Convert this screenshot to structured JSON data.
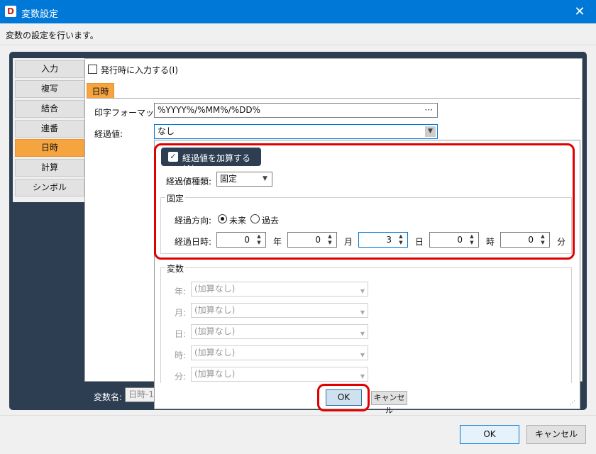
{
  "window": {
    "title": "変数設定",
    "icon_letter": "D",
    "close_glyph": "✕"
  },
  "description": "変数の設定を行います。",
  "nav": {
    "items": [
      "入力",
      "複写",
      "結合",
      "連番",
      "日時",
      "計算",
      "シンボル"
    ],
    "active_index": 4
  },
  "input_on_issue": {
    "label": "発行時に入力する(I)",
    "checked": false
  },
  "tab_label": "日時",
  "print_format": {
    "label": "印字フォーマット:",
    "value": "%YYYY%/%MM%/%DD%",
    "button": "···"
  },
  "elapsed": {
    "label": "経過値:",
    "value": "なし"
  },
  "popup": {
    "add_checkbox_label": "経過値を加算する(A)",
    "add_checked": true,
    "type_label": "経過値種類:",
    "type_value": "固定",
    "fixed_group": "固定",
    "direction_label": "経過方向:",
    "direction_future": "未来",
    "direction_past": "過去",
    "direction_selected": "未来",
    "datetime_label": "経過日時:",
    "spins": [
      {
        "value": "0",
        "unit": "年"
      },
      {
        "value": "0",
        "unit": "月"
      },
      {
        "value": "3",
        "unit": "日"
      },
      {
        "value": "0",
        "unit": "時"
      },
      {
        "value": "0",
        "unit": "分"
      }
    ],
    "variable_group": "変数",
    "variable_rows": [
      {
        "label": "年:",
        "value": "(加算なし)"
      },
      {
        "label": "月:",
        "value": "(加算なし)"
      },
      {
        "label": "日:",
        "value": "(加算なし)"
      },
      {
        "label": "時:",
        "value": "(加算なし)"
      },
      {
        "label": "分:",
        "value": "(加算なし)"
      }
    ],
    "ok": "OK",
    "cancel": "キャンセル"
  },
  "var_name": {
    "label": "変数名:",
    "value": "日時-1"
  },
  "footer": {
    "ok": "OK",
    "cancel": "キャンセル"
  },
  "colors": {
    "titlebar": "#0078d7",
    "frame": "#2d3e52",
    "accent": "#f5a43f",
    "highlight": "#e00000"
  }
}
